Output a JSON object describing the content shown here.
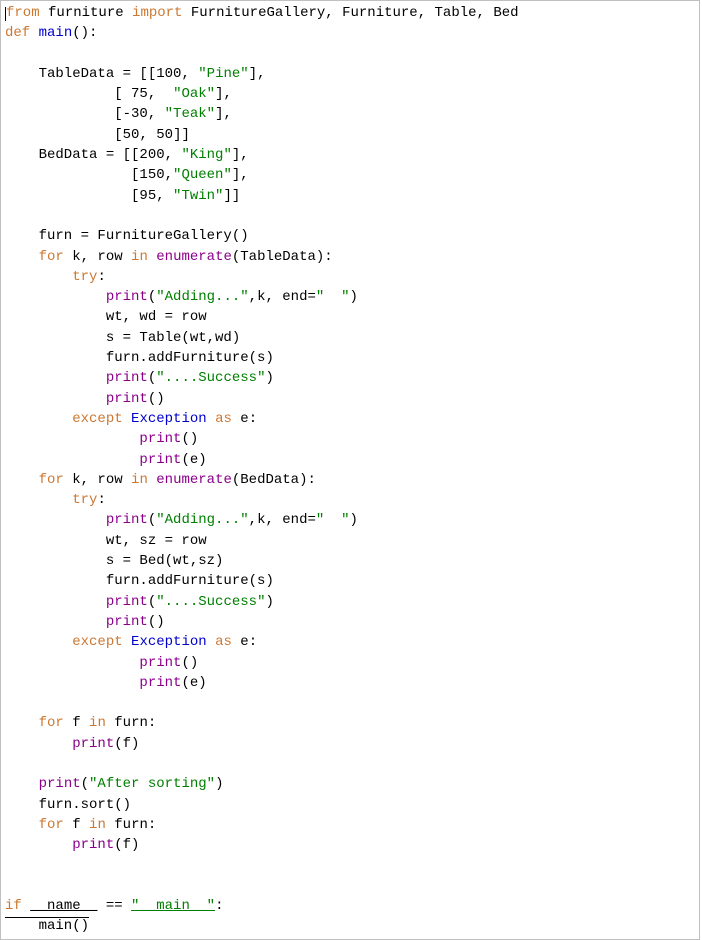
{
  "code": {
    "line1": {
      "from": "from",
      "module": "furniture",
      "import": "import",
      "names": "FurnitureGallery, Furniture, Table, Bed"
    },
    "line2": {
      "def": "def",
      "fn": "main",
      "paren": "():"
    },
    "line4a": "    TableData = [[",
    "line4b": "100",
    "line4c": ", ",
    "line4d": "\"Pine\"",
    "line4e": "],",
    "line5a": "             [ ",
    "line5b": "75",
    "line5c": ",  ",
    "line5d": "\"Oak\"",
    "line5e": "],",
    "line6a": "             [",
    "line6b": "-30",
    "line6c": ", ",
    "line6d": "\"Teak\"",
    "line6e": "],",
    "line7a": "             [",
    "line7b": "50",
    "line7c": ", ",
    "line7d": "50",
    "line7e": "]]",
    "line8a": "    BedData = [[",
    "line8b": "200",
    "line8c": ", ",
    "line8d": "\"King\"",
    "line8e": "],",
    "line9a": "               [",
    "line9b": "150",
    "line9c": ",",
    "line9d": "\"Queen\"",
    "line9e": "],",
    "line10a": "               [",
    "line10b": "95",
    "line10c": ", ",
    "line10d": "\"Twin\"",
    "line10e": "]]",
    "line12": "    furn = FurnitureGallery()",
    "line13": {
      "for": "for",
      "vars": " k, row ",
      "in": "in",
      "call": " enumerate",
      "arg": "(TableData):"
    },
    "line14": {
      "indent": "        ",
      "try": "try",
      "colon": ":"
    },
    "line15": {
      "indent": "            ",
      "print": "print",
      "op": "(",
      "s1": "\"Adding...\"",
      "mid": ",k, end=",
      "s2": "\"  \"",
      "cl": ")"
    },
    "line16": "            wt, wd = row",
    "line17": "            s = Table(wt,wd)",
    "line18": "            furn.addFurniture(s)",
    "line19": {
      "indent": "            ",
      "print": "print",
      "op": "(",
      "s1": "\"....Success\"",
      "cl": ")"
    },
    "line20": {
      "indent": "            ",
      "print": "print",
      "paren": "()"
    },
    "line21": {
      "indent": "        ",
      "except": "except",
      "sp": " ",
      "exc": "Exception",
      "as": " as ",
      "asKw": "as",
      "e": " e:"
    },
    "line22": {
      "indent": "                ",
      "print": "print",
      "paren": "()"
    },
    "line23": {
      "indent": "                ",
      "print": "print",
      "paren": "(e)"
    },
    "line24": {
      "for": "for",
      "vars": " k, row ",
      "in": "in",
      "call": " enumerate",
      "arg": "(BedData):"
    },
    "line25": {
      "indent": "        ",
      "try": "try",
      "colon": ":"
    },
    "line26": {
      "indent": "            ",
      "print": "print",
      "op": "(",
      "s1": "\"Adding...\"",
      "mid": ",k, end=",
      "s2": "\"  \"",
      "cl": ")"
    },
    "line27": "            wt, sz = row",
    "line28": "            s = Bed(wt,sz)",
    "line29": "            furn.addFurniture(s)",
    "line30": {
      "indent": "            ",
      "print": "print",
      "op": "(",
      "s1": "\"....Success\"",
      "cl": ")"
    },
    "line31": {
      "indent": "            ",
      "print": "print",
      "paren": "()"
    },
    "line32": {
      "indent": "        ",
      "except": "except",
      "sp": " ",
      "exc": "Exception",
      "as": " as ",
      "asKw": "as",
      "e": " e:"
    },
    "line33": {
      "indent": "                ",
      "print": "print",
      "paren": "()"
    },
    "line34": {
      "indent": "                ",
      "print": "print",
      "paren": "(e)"
    },
    "line36": {
      "indent": "    ",
      "for": "for",
      "vars": " f ",
      "in": "in",
      "rest": " furn:"
    },
    "line37": {
      "indent": "        ",
      "print": "print",
      "paren": "(f)"
    },
    "line39": {
      "indent": "    ",
      "print": "print",
      "op": "(",
      "s1": "\"After sorting\"",
      "cl": ")"
    },
    "line40": "    furn.sort()",
    "line41": {
      "indent": "    ",
      "for": "for",
      "vars": " f ",
      "in": "in",
      "rest": " furn:"
    },
    "line42": {
      "indent": "        ",
      "print": "print",
      "paren": "(f)"
    },
    "line45": {
      "if": "if",
      "name": " __name__ == ",
      "nameVar": "__name__",
      "eq": " == ",
      "str": "\"__main__\"",
      "colon": ":"
    },
    "line46": "    main()"
  }
}
